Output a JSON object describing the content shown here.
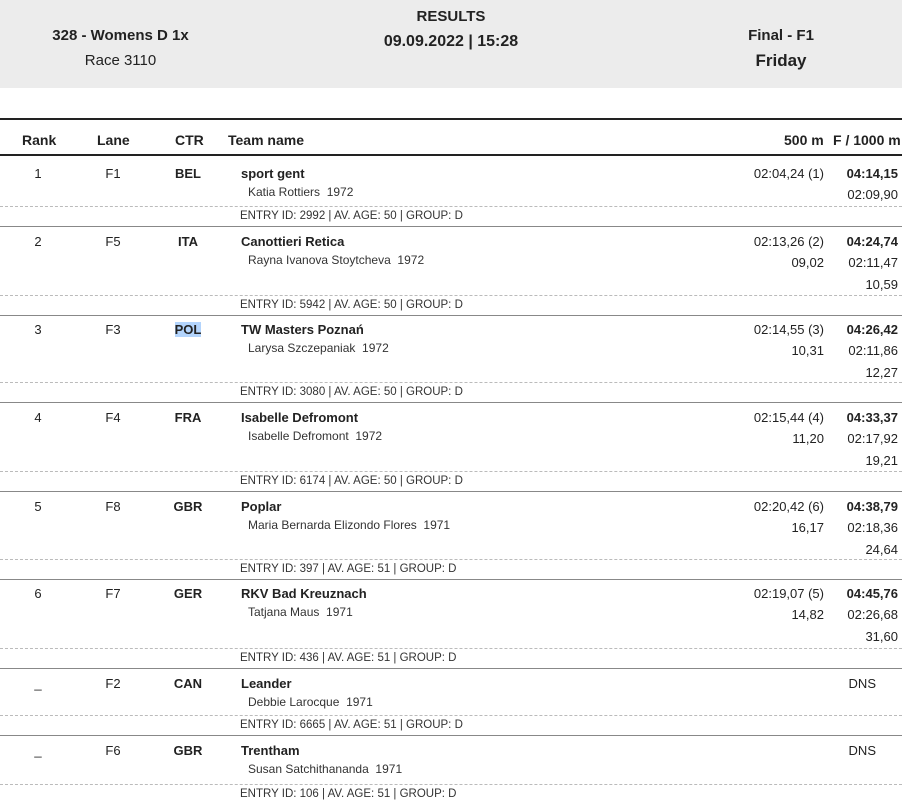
{
  "header": {
    "race_title": "328 - Womens D 1x",
    "race_number": "Race 3110",
    "results_label": "RESULTS",
    "datetime": "09.09.2022 | 15:28",
    "phase": "Final - F1",
    "day": "Friday"
  },
  "columns": {
    "rank": "Rank",
    "lane": "Lane",
    "ctr": "CTR",
    "team": "Team name",
    "split": "500 m",
    "final": "F / 1000 m"
  },
  "rows": [
    {
      "rank": "1",
      "lane": "F1",
      "ctr": "BEL",
      "team": "sport gent",
      "crew": "Katia Rottiers  1972",
      "split": "02:04,24 (1)",
      "split_diff": "",
      "final": "04:14,15",
      "final_split": "02:09,90",
      "final_diff": "",
      "entry": "ENTRY ID: 2992 | AV. AGE: 50 | GROUP: D"
    },
    {
      "rank": "2",
      "lane": "F5",
      "ctr": "ITA",
      "team": "Canottieri Retica",
      "crew": "Rayna Ivanova Stoytcheva  1972",
      "split": "02:13,26 (2)",
      "split_diff": "09,02",
      "final": "04:24,74",
      "final_split": "02:11,47",
      "final_diff": "10,59",
      "entry": "ENTRY ID: 5942 | AV. AGE: 50 | GROUP: D"
    },
    {
      "rank": "3",
      "lane": "F3",
      "ctr": "POL",
      "team": "TW Masters Poznań",
      "crew": "Larysa Szczepaniak  1972",
      "split": "02:14,55 (3)",
      "split_diff": "10,31",
      "final": "04:26,42",
      "final_split": "02:11,86",
      "final_diff": "12,27",
      "entry": "ENTRY ID: 3080 | AV. AGE: 50 | GROUP: D"
    },
    {
      "rank": "4",
      "lane": "F4",
      "ctr": "FRA",
      "team": "Isabelle Defromont",
      "crew": "Isabelle Defromont  1972",
      "split": "02:15,44 (4)",
      "split_diff": "11,20",
      "final": "04:33,37",
      "final_split": "02:17,92",
      "final_diff": "19,21",
      "entry": "ENTRY ID: 6174 | AV. AGE: 50 | GROUP: D"
    },
    {
      "rank": "5",
      "lane": "F8",
      "ctr": "GBR",
      "team": "Poplar",
      "crew": "Maria Bernarda Elizondo Flores  1971",
      "split": "02:20,42 (6)",
      "split_diff": "16,17",
      "final": "04:38,79",
      "final_split": "02:18,36",
      "final_diff": "24,64",
      "entry": "ENTRY ID: 397 | AV. AGE: 51 | GROUP: D"
    },
    {
      "rank": "6",
      "lane": "F7",
      "ctr": "GER",
      "team": "RKV Bad Kreuznach",
      "crew": "Tatjana Maus  1971",
      "split": "02:19,07 (5)",
      "split_diff": "14,82",
      "final": "04:45,76",
      "final_split": "02:26,68",
      "final_diff": "31,60",
      "entry": "ENTRY ID: 436 | AV. AGE: 51 | GROUP: D"
    },
    {
      "rank": "_",
      "lane": "F2",
      "ctr": "CAN",
      "team": "Leander",
      "crew": "Debbie Larocque  1971",
      "status": "DNS",
      "entry": "ENTRY ID: 6665 | AV. AGE: 51 | GROUP: D"
    },
    {
      "rank": "_",
      "lane": "F6",
      "ctr": "GBR",
      "team": "Trentham",
      "crew": "Susan Satchithananda  1971",
      "status": "DNS",
      "entry": "ENTRY ID: 106 | AV. AGE: 51 | GROUP: D"
    }
  ]
}
